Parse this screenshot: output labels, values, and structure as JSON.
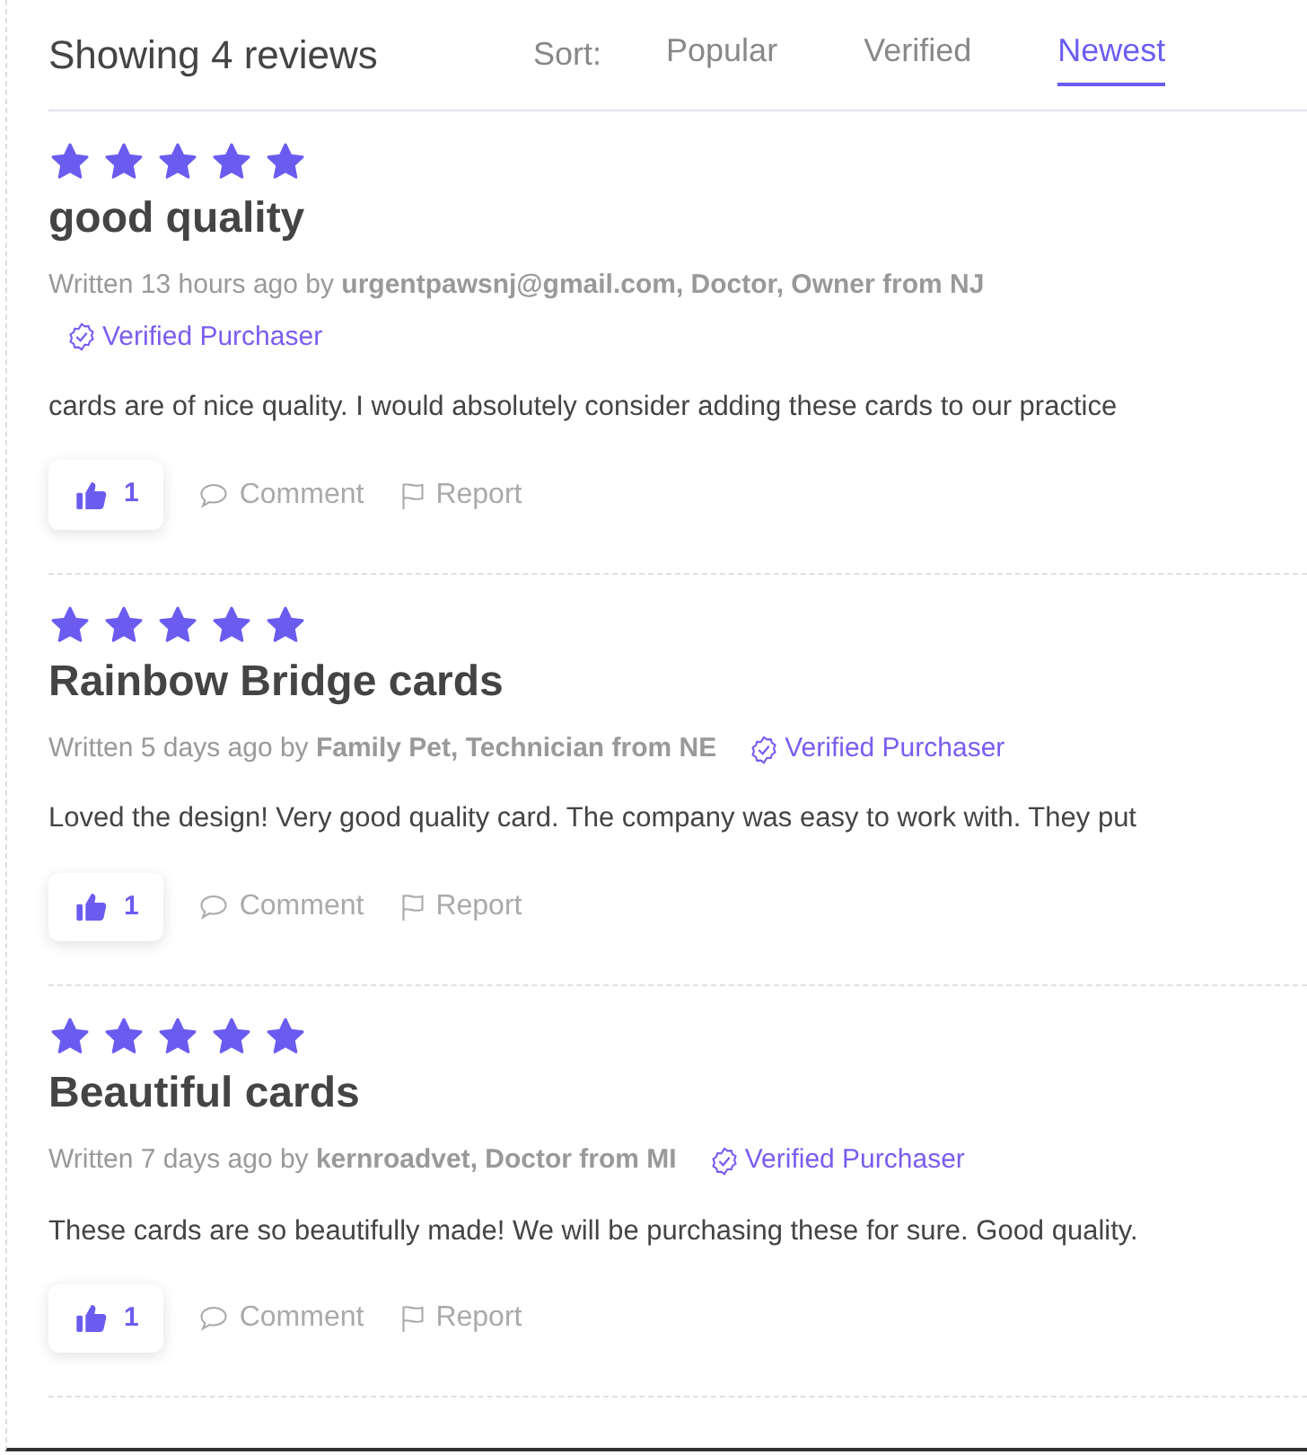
{
  "summary": "Showing 4 reviews",
  "sort": {
    "label": "Sort:",
    "options": [
      {
        "label": "Popular",
        "selected": false
      },
      {
        "label": "Verified",
        "selected": false
      },
      {
        "label": "Newest",
        "selected": true
      }
    ]
  },
  "reviews": [
    {
      "stars": 5,
      "title": "good quality",
      "written": "Written 13 hours ago by",
      "author": "urgentpawsnj@gmail.com, Doctor, Owner from NJ",
      "verified": "Verified Purchaser",
      "body": "cards are of nice quality. I would absolutely consider adding these cards to our practice",
      "likes": "1",
      "comment": "Comment",
      "report": "Report"
    },
    {
      "stars": 5,
      "title": "Rainbow Bridge cards",
      "written": "Written 5 days ago by",
      "author": "Family Pet, Technician from NE",
      "verified": "Verified Purchaser",
      "body": "Loved the design! Very good quality card. The company was easy to work with. They put",
      "likes": "1",
      "comment": "Comment",
      "report": "Report"
    },
    {
      "stars": 5,
      "title": "Beautiful cards",
      "written": "Written 7 days ago by",
      "author": "kernroadvet, Doctor from MI",
      "verified": "Verified Purchaser",
      "body": "These cards are so beautifully made! We will be purchasing these for sure. Good quality.",
      "likes": "1",
      "comment": "Comment",
      "report": "Report"
    }
  ]
}
